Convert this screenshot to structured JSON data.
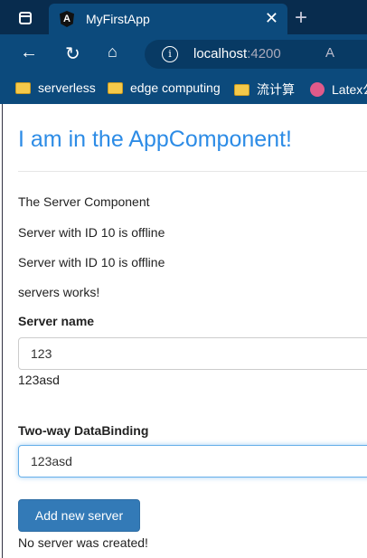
{
  "browser": {
    "tab_title": "MyFirstApp",
    "url_host": "localhost",
    "url_port": ":4200",
    "bookmarks": [
      "serverless",
      "edge computing",
      "流计算",
      "Latex公"
    ]
  },
  "app": {
    "heading": "I am in the AppComponent!",
    "lines": [
      "The Server Component",
      "Server with ID 10 is offline",
      "Server with ID 10 is offline",
      "servers works!"
    ],
    "server_name_label": "Server name",
    "server_name_value": "123",
    "server_name_echo": "123asd",
    "twoway_label": "Two-way DataBinding",
    "twoway_value": "123asd",
    "add_button": "Add new server",
    "status": "No server was created!"
  },
  "colors": {
    "accent": "#337ab7",
    "heading": "#2d8ce6",
    "chrome": "#0c4a7c"
  }
}
